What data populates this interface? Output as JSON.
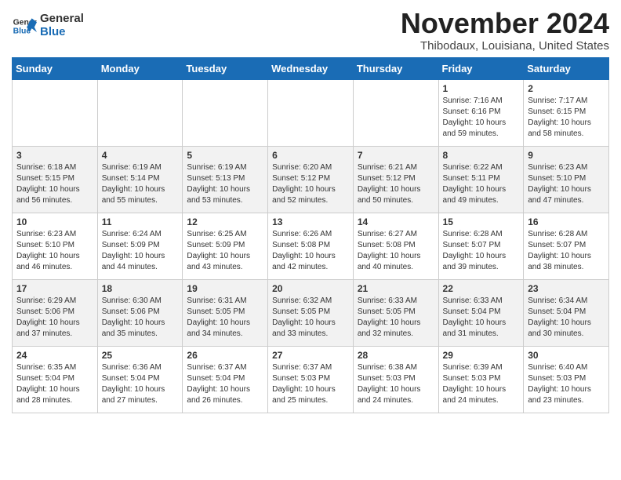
{
  "logo": {
    "text_general": "General",
    "text_blue": "Blue"
  },
  "title": "November 2024",
  "location": "Thibodaux, Louisiana, United States",
  "weekdays": [
    "Sunday",
    "Monday",
    "Tuesday",
    "Wednesday",
    "Thursday",
    "Friday",
    "Saturday"
  ],
  "weeks": [
    [
      {
        "day": "",
        "text": ""
      },
      {
        "day": "",
        "text": ""
      },
      {
        "day": "",
        "text": ""
      },
      {
        "day": "",
        "text": ""
      },
      {
        "day": "",
        "text": ""
      },
      {
        "day": "1",
        "text": "Sunrise: 7:16 AM\nSunset: 6:16 PM\nDaylight: 10 hours and 59 minutes."
      },
      {
        "day": "2",
        "text": "Sunrise: 7:17 AM\nSunset: 6:15 PM\nDaylight: 10 hours and 58 minutes."
      }
    ],
    [
      {
        "day": "3",
        "text": "Sunrise: 6:18 AM\nSunset: 5:15 PM\nDaylight: 10 hours and 56 minutes."
      },
      {
        "day": "4",
        "text": "Sunrise: 6:19 AM\nSunset: 5:14 PM\nDaylight: 10 hours and 55 minutes."
      },
      {
        "day": "5",
        "text": "Sunrise: 6:19 AM\nSunset: 5:13 PM\nDaylight: 10 hours and 53 minutes."
      },
      {
        "day": "6",
        "text": "Sunrise: 6:20 AM\nSunset: 5:12 PM\nDaylight: 10 hours and 52 minutes."
      },
      {
        "day": "7",
        "text": "Sunrise: 6:21 AM\nSunset: 5:12 PM\nDaylight: 10 hours and 50 minutes."
      },
      {
        "day": "8",
        "text": "Sunrise: 6:22 AM\nSunset: 5:11 PM\nDaylight: 10 hours and 49 minutes."
      },
      {
        "day": "9",
        "text": "Sunrise: 6:23 AM\nSunset: 5:10 PM\nDaylight: 10 hours and 47 minutes."
      }
    ],
    [
      {
        "day": "10",
        "text": "Sunrise: 6:23 AM\nSunset: 5:10 PM\nDaylight: 10 hours and 46 minutes."
      },
      {
        "day": "11",
        "text": "Sunrise: 6:24 AM\nSunset: 5:09 PM\nDaylight: 10 hours and 44 minutes."
      },
      {
        "day": "12",
        "text": "Sunrise: 6:25 AM\nSunset: 5:09 PM\nDaylight: 10 hours and 43 minutes."
      },
      {
        "day": "13",
        "text": "Sunrise: 6:26 AM\nSunset: 5:08 PM\nDaylight: 10 hours and 42 minutes."
      },
      {
        "day": "14",
        "text": "Sunrise: 6:27 AM\nSunset: 5:08 PM\nDaylight: 10 hours and 40 minutes."
      },
      {
        "day": "15",
        "text": "Sunrise: 6:28 AM\nSunset: 5:07 PM\nDaylight: 10 hours and 39 minutes."
      },
      {
        "day": "16",
        "text": "Sunrise: 6:28 AM\nSunset: 5:07 PM\nDaylight: 10 hours and 38 minutes."
      }
    ],
    [
      {
        "day": "17",
        "text": "Sunrise: 6:29 AM\nSunset: 5:06 PM\nDaylight: 10 hours and 37 minutes."
      },
      {
        "day": "18",
        "text": "Sunrise: 6:30 AM\nSunset: 5:06 PM\nDaylight: 10 hours and 35 minutes."
      },
      {
        "day": "19",
        "text": "Sunrise: 6:31 AM\nSunset: 5:05 PM\nDaylight: 10 hours and 34 minutes."
      },
      {
        "day": "20",
        "text": "Sunrise: 6:32 AM\nSunset: 5:05 PM\nDaylight: 10 hours and 33 minutes."
      },
      {
        "day": "21",
        "text": "Sunrise: 6:33 AM\nSunset: 5:05 PM\nDaylight: 10 hours and 32 minutes."
      },
      {
        "day": "22",
        "text": "Sunrise: 6:33 AM\nSunset: 5:04 PM\nDaylight: 10 hours and 31 minutes."
      },
      {
        "day": "23",
        "text": "Sunrise: 6:34 AM\nSunset: 5:04 PM\nDaylight: 10 hours and 30 minutes."
      }
    ],
    [
      {
        "day": "24",
        "text": "Sunrise: 6:35 AM\nSunset: 5:04 PM\nDaylight: 10 hours and 28 minutes."
      },
      {
        "day": "25",
        "text": "Sunrise: 6:36 AM\nSunset: 5:04 PM\nDaylight: 10 hours and 27 minutes."
      },
      {
        "day": "26",
        "text": "Sunrise: 6:37 AM\nSunset: 5:04 PM\nDaylight: 10 hours and 26 minutes."
      },
      {
        "day": "27",
        "text": "Sunrise: 6:37 AM\nSunset: 5:03 PM\nDaylight: 10 hours and 25 minutes."
      },
      {
        "day": "28",
        "text": "Sunrise: 6:38 AM\nSunset: 5:03 PM\nDaylight: 10 hours and 24 minutes."
      },
      {
        "day": "29",
        "text": "Sunrise: 6:39 AM\nSunset: 5:03 PM\nDaylight: 10 hours and 24 minutes."
      },
      {
        "day": "30",
        "text": "Sunrise: 6:40 AM\nSunset: 5:03 PM\nDaylight: 10 hours and 23 minutes."
      }
    ]
  ]
}
